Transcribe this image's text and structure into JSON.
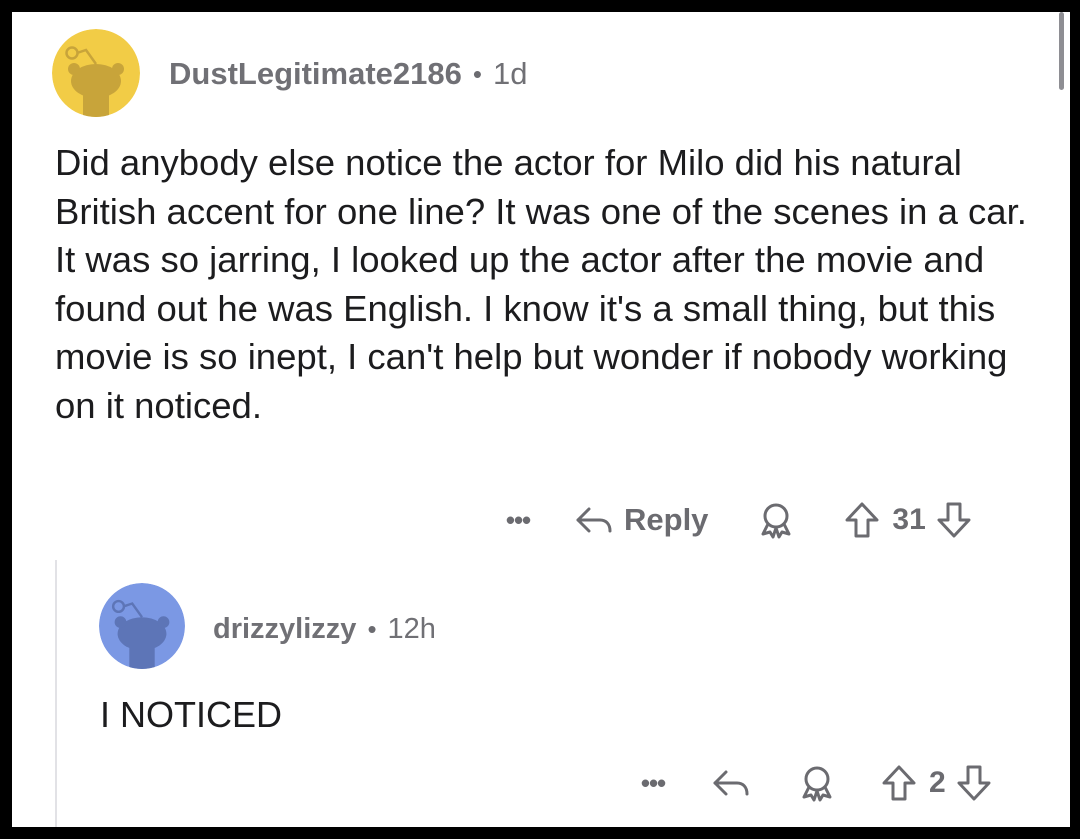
{
  "comments": [
    {
      "username": "DustLegitimate2186",
      "separator": "•",
      "time": "1d",
      "body": "Did anybody else notice the actor for Milo did his natural British accent for one line? It was one of the scenes in a car. It was so jarring, I looked up the actor after the movie and found out he was English. I know it's a small thing, but this movie is so inept, I can't help but wonder if nobody working on it noticed.",
      "avatar_color": "#f2cc46",
      "more_label": "•••",
      "reply_label": "Reply",
      "score": "31"
    },
    {
      "username": "drizzylizzy",
      "separator": "•",
      "time": "12h",
      "body": "I NOTICED",
      "avatar_color": "#7b98e4",
      "more_label": "•••",
      "score": "2"
    }
  ],
  "icons": {
    "avatar": "snoo-avatar-icon",
    "more": "more-options-icon",
    "reply": "reply-arrow-icon",
    "award": "award-icon",
    "upvote": "upvote-arrow-icon",
    "downvote": "downvote-arrow-icon"
  }
}
